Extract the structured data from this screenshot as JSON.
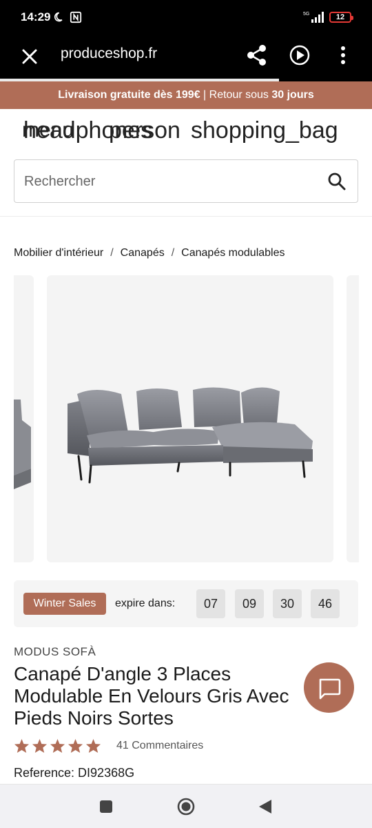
{
  "status_bar": {
    "time": "14:29",
    "signal_label": "5G",
    "battery": "12",
    "icons": [
      "moon-icon",
      "nfc-icon",
      "signal-icon",
      "battery-icon"
    ]
  },
  "browser": {
    "url": "produceshop.fr",
    "icons": [
      "close-icon",
      "share-icon",
      "play-circle-icon",
      "more-vert-icon"
    ],
    "load_progress": 0.75
  },
  "promo": {
    "part1": "Livraison gratuite dès ",
    "part2": "199€",
    "separator": " | ",
    "part3": "Retour sous ",
    "part4": "30 jours"
  },
  "header": {
    "menu_text": "menu",
    "headphones_text": "headphones",
    "person_text": "person",
    "bag_text": "shopping_bag"
  },
  "search": {
    "placeholder": "Rechercher",
    "icon": "search-icon"
  },
  "breadcrumb": {
    "items": [
      "Mobilier d'intérieur",
      "Canapés",
      "Canapés modulables"
    ],
    "separator": "/"
  },
  "countdown": {
    "badge": "Winter Sales",
    "label": "expire dans:",
    "values": [
      "07",
      "09",
      "30",
      "46"
    ]
  },
  "product": {
    "brand": "MODUS SOFÀ",
    "title": "Canapé D'angle 3 Places Modulable En Velours Gris Avec Pieds Noirs Sortes",
    "rating": 5,
    "reviews": "41 Commentaires",
    "reference": "Reference: DI92368G"
  },
  "colors": {
    "accent": "#b06d57",
    "background": "#ffffff",
    "panel": "#f5f5f5",
    "star": "#b06d57"
  }
}
